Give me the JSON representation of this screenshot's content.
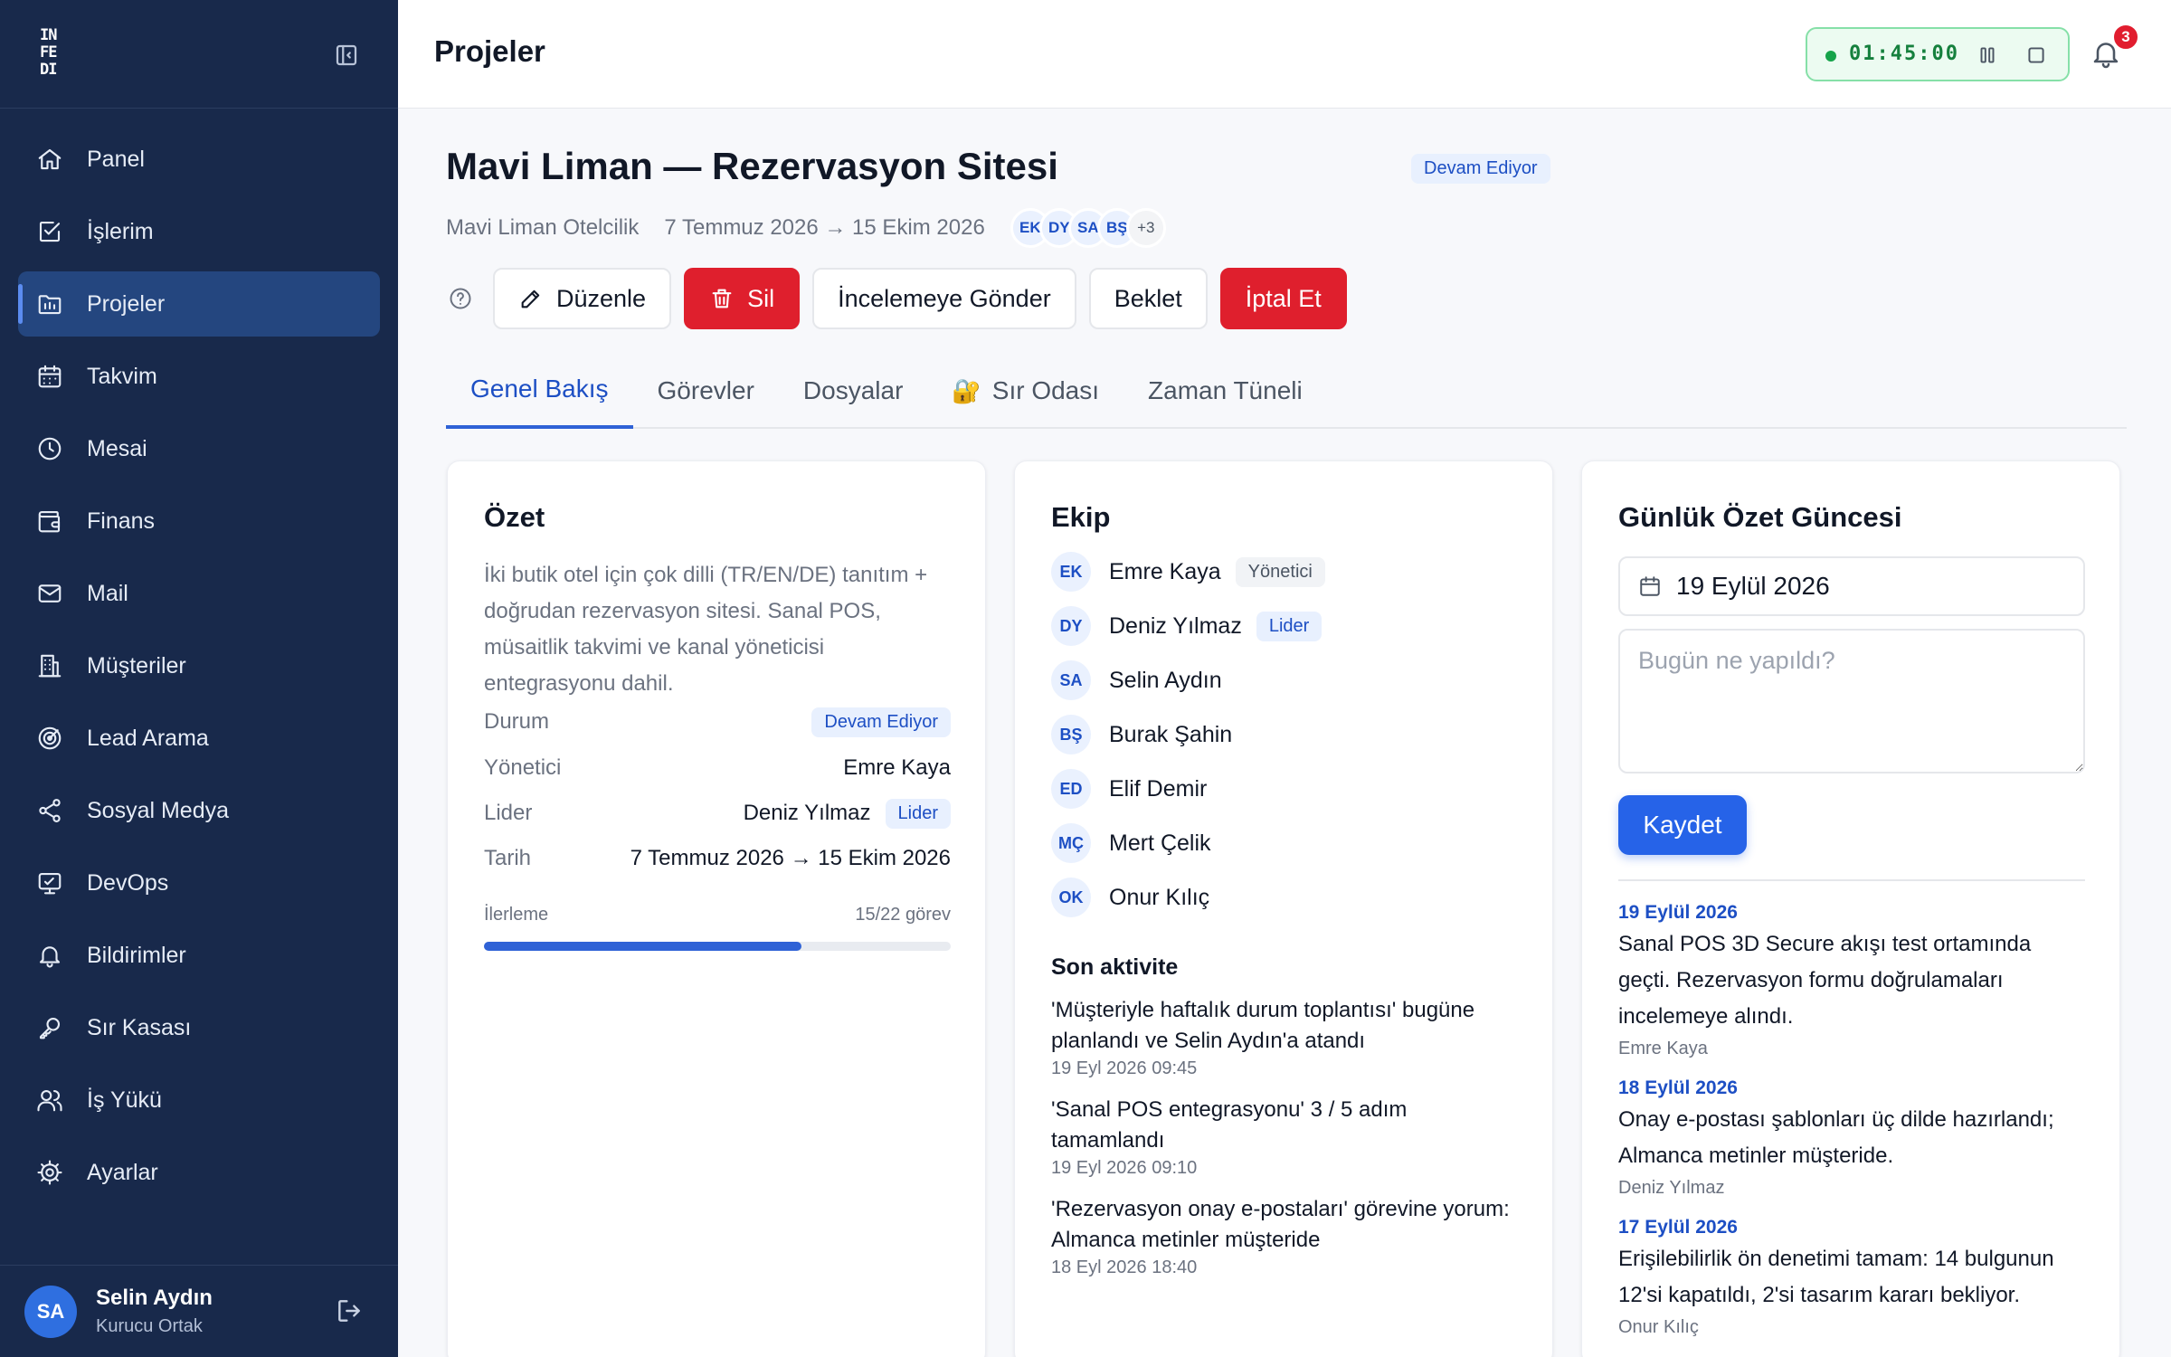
{
  "sidebar": {
    "logo_lines": [
      "IN",
      "FE",
      "DI"
    ],
    "items": [
      {
        "label": "Panel",
        "icon": "home-icon"
      },
      {
        "label": "İşlerim",
        "icon": "checklist-icon"
      },
      {
        "label": "Projeler",
        "icon": "folder-icon",
        "active": true
      },
      {
        "label": "Takvim",
        "icon": "calendar-icon"
      },
      {
        "label": "Mesai",
        "icon": "clock-icon"
      },
      {
        "label": "Finans",
        "icon": "wallet-icon"
      },
      {
        "label": "Mail",
        "icon": "mail-icon"
      },
      {
        "label": "Müşteriler",
        "icon": "building-icon"
      },
      {
        "label": "Lead Arama",
        "icon": "target-icon"
      },
      {
        "label": "Sosyal Medya",
        "icon": "share-icon"
      },
      {
        "label": "DevOps",
        "icon": "monitor-icon"
      },
      {
        "label": "Bildirimler",
        "icon": "bell-icon"
      },
      {
        "label": "Sır Kasası",
        "icon": "key-icon"
      },
      {
        "label": "İş Yükü",
        "icon": "users-icon"
      },
      {
        "label": "Ayarlar",
        "icon": "gear-icon"
      }
    ],
    "user": {
      "initials": "SA",
      "name": "Selin Aydın",
      "role": "Kurucu Ortak"
    }
  },
  "topbar": {
    "title": "Projeler",
    "timer": "01:45:00",
    "notification_count": "3"
  },
  "project": {
    "title": "Mavi Liman — Rezervasyon Sitesi",
    "status": "Devam Ediyor",
    "client": "Mavi Liman Otelcilik",
    "dates": "7 Temmuz 2026 → 15 Ekim 2026",
    "avatars": [
      "EK",
      "DY",
      "SA",
      "BŞ"
    ],
    "avatars_more": "+3"
  },
  "actions": {
    "edit": "Düzenle",
    "delete": "Sil",
    "review": "İncelemeye Gönder",
    "hold": "Beklet",
    "cancel": "İptal Et"
  },
  "tabs": [
    {
      "label": "Genel Bakış",
      "active": true
    },
    {
      "label": "Görevler"
    },
    {
      "label": "Dosyalar"
    },
    {
      "label": "Sır Odası",
      "icon": "🔐"
    },
    {
      "label": "Zaman Tüneli"
    }
  ],
  "ozet": {
    "title": "Özet",
    "description": "İki butik otel için çok dilli (TR/EN/DE) tanıtım + doğrudan rezervasyon sitesi. Sanal POS, müsaitlik takvimi ve kanal yöneticisi entegrasyonu dahil.",
    "status_label": "Durum",
    "status_value": "Devam Ediyor",
    "manager_label": "Yönetici",
    "manager_value": "Emre Kaya",
    "lead_label": "Lider",
    "lead_value": "Deniz Yılmaz",
    "lead_badge": "Lider",
    "date_label": "Tarih",
    "date_value": "7 Temmuz 2026 → 15 Ekim 2026",
    "progress_label": "İlerleme",
    "progress_value": "15/22 görev",
    "progress_fraction": 0.68
  },
  "ekip": {
    "title": "Ekip",
    "members": [
      {
        "initials": "EK",
        "name": "Emre Kaya",
        "role": "Yönetici",
        "role_style": "gray"
      },
      {
        "initials": "DY",
        "name": "Deniz Yılmaz",
        "role": "Lider",
        "role_style": "blue"
      },
      {
        "initials": "SA",
        "name": "Selin Aydın",
        "role": ""
      },
      {
        "initials": "BŞ",
        "name": "Burak Şahin",
        "role": ""
      },
      {
        "initials": "ED",
        "name": "Elif Demir",
        "role": ""
      },
      {
        "initials": "MÇ",
        "name": "Mert Çelik",
        "role": ""
      },
      {
        "initials": "OK",
        "name": "Onur Kılıç",
        "role": ""
      }
    ],
    "activity_title": "Son aktivite",
    "activities": [
      {
        "text": "'Müşteriyle haftalık durum toplantısı' bugüne planlandı ve Selin Aydın'a atandı",
        "time": "19 Eyl 2026 09:45"
      },
      {
        "text": "'Sanal POS entegrasyonu' 3 / 5 adım tamamlandı",
        "time": "19 Eyl 2026 09:10"
      },
      {
        "text": "'Rezervasyon onay e-postaları' görevine yorum: Almanca metinler müşteride",
        "time": "18 Eyl 2026 18:40"
      }
    ]
  },
  "gunluk": {
    "title": "Günlük Özet Güncesi",
    "date_value": "19 Eylül 2026",
    "placeholder": "Bugün ne yapıldı?",
    "save_label": "Kaydet",
    "entries": [
      {
        "date": "19 Eylül 2026",
        "text": "Sanal POS 3D Secure akışı test ortamında geçti. Rezervasyon formu doğrulamaları incelemeye alındı.",
        "author": "Emre Kaya"
      },
      {
        "date": "18 Eylül 2026",
        "text": "Onay e-postası şablonları üç dilde hazırlandı; Almanca metinler müşteride.",
        "author": "Deniz Yılmaz"
      },
      {
        "date": "17 Eylül 2026",
        "text": "Erişilebilirlik ön denetimi tamam: 14 bulgunun 12'si kapatıldı, 2'si tasarım kararı bekliyor.",
        "author": "Onur Kılıç"
      }
    ]
  },
  "colors": {
    "sidebar": "#18294b",
    "accent": "#2f62d6",
    "danger": "#df1f2d",
    "success": "#16a34a"
  }
}
